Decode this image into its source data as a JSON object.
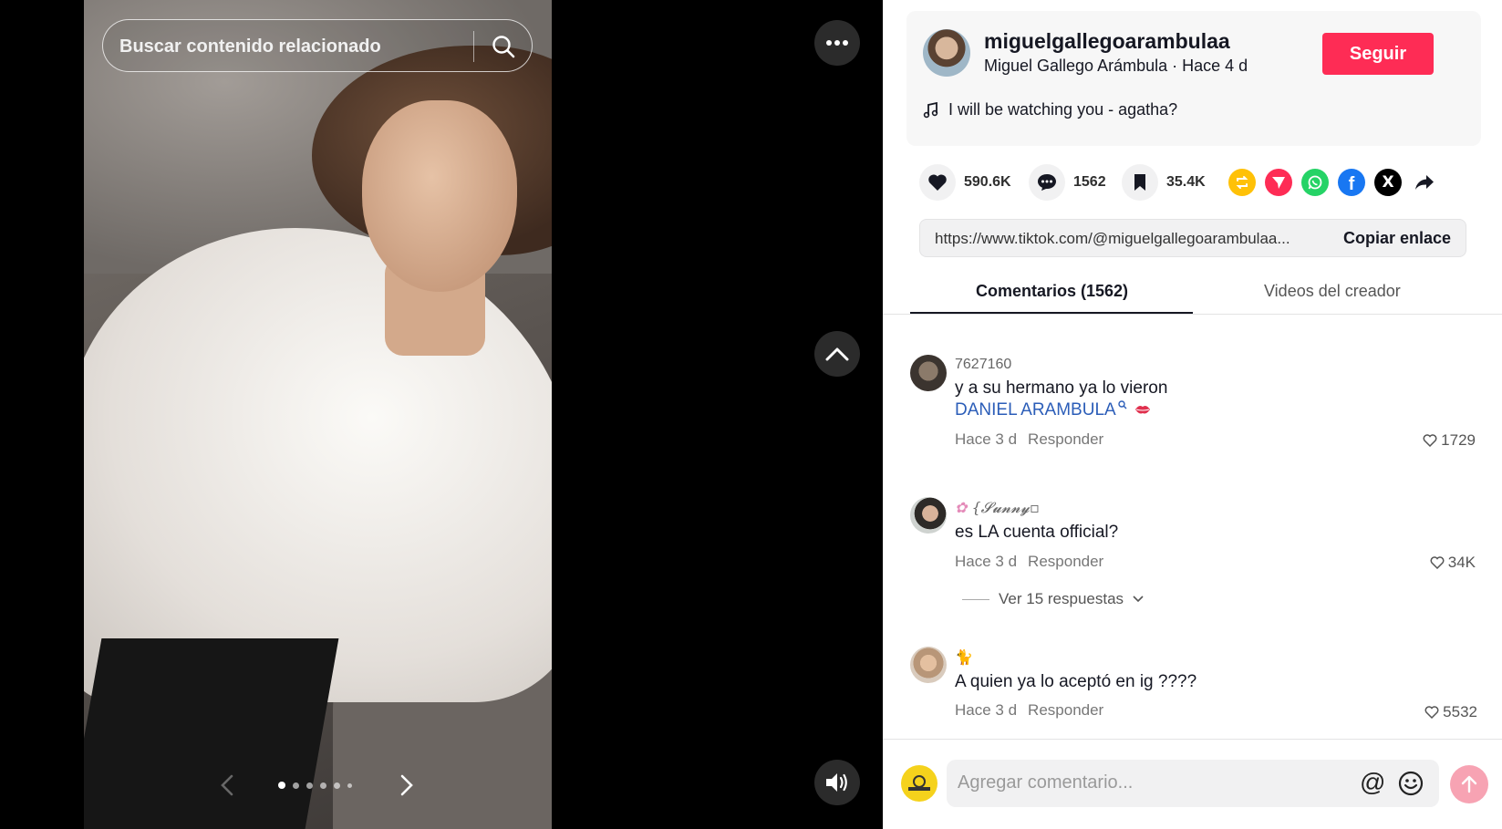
{
  "search": {
    "placeholder": "Buscar contenido relacionado"
  },
  "carousel": {
    "current_slide": 1,
    "total_dots": 6
  },
  "creator": {
    "username": "miguelgallegoarambulaa",
    "display_line": "Miguel Gallego Arámbula · Hace 4 d",
    "follow_label": "Seguir",
    "music": "I will be watching you - agatha?"
  },
  "stats": {
    "likes": "590.6K",
    "comments": "1562",
    "saves": "35.4K"
  },
  "share_icons": [
    "repost-icon",
    "send-icon",
    "whatsapp-icon",
    "facebook-icon",
    "x-icon",
    "share-arrow-icon"
  ],
  "colors": {
    "accent": "#fe2c55",
    "repost": "#ffc107",
    "send": "#fe2c55",
    "whatsapp": "#25d366",
    "facebook": "#1877f2",
    "x": "#000000"
  },
  "link": {
    "url": "https://www.tiktok.com/@miguelgallegoarambulaa...",
    "copy_label": "Copiar enlace"
  },
  "tabs": [
    {
      "label": "Comentarios (1562)"
    },
    {
      "label": "Videos del creador"
    }
  ],
  "comments": [
    {
      "user": "7627160",
      "text": "y a su hermano ya lo vieron",
      "mention": "DANIEL ARAMBULA",
      "time": "Hace 3 d",
      "reply": "Responder",
      "likes": "1729"
    },
    {
      "user": "{𝓢𝓾𝓷𝓷𝔂▫",
      "text": "es LA cuenta official?",
      "time": "Hace 3 d",
      "reply": "Responder",
      "likes": "34K",
      "replies_label": "Ver 15 respuestas"
    },
    {
      "user": "",
      "text": "A quien ya lo aceptó en ig ????",
      "time": "Hace 3 d",
      "reply": "Responder",
      "likes": "5532"
    }
  ],
  "composer": {
    "placeholder": "Agregar comentario...",
    "at": "@"
  }
}
